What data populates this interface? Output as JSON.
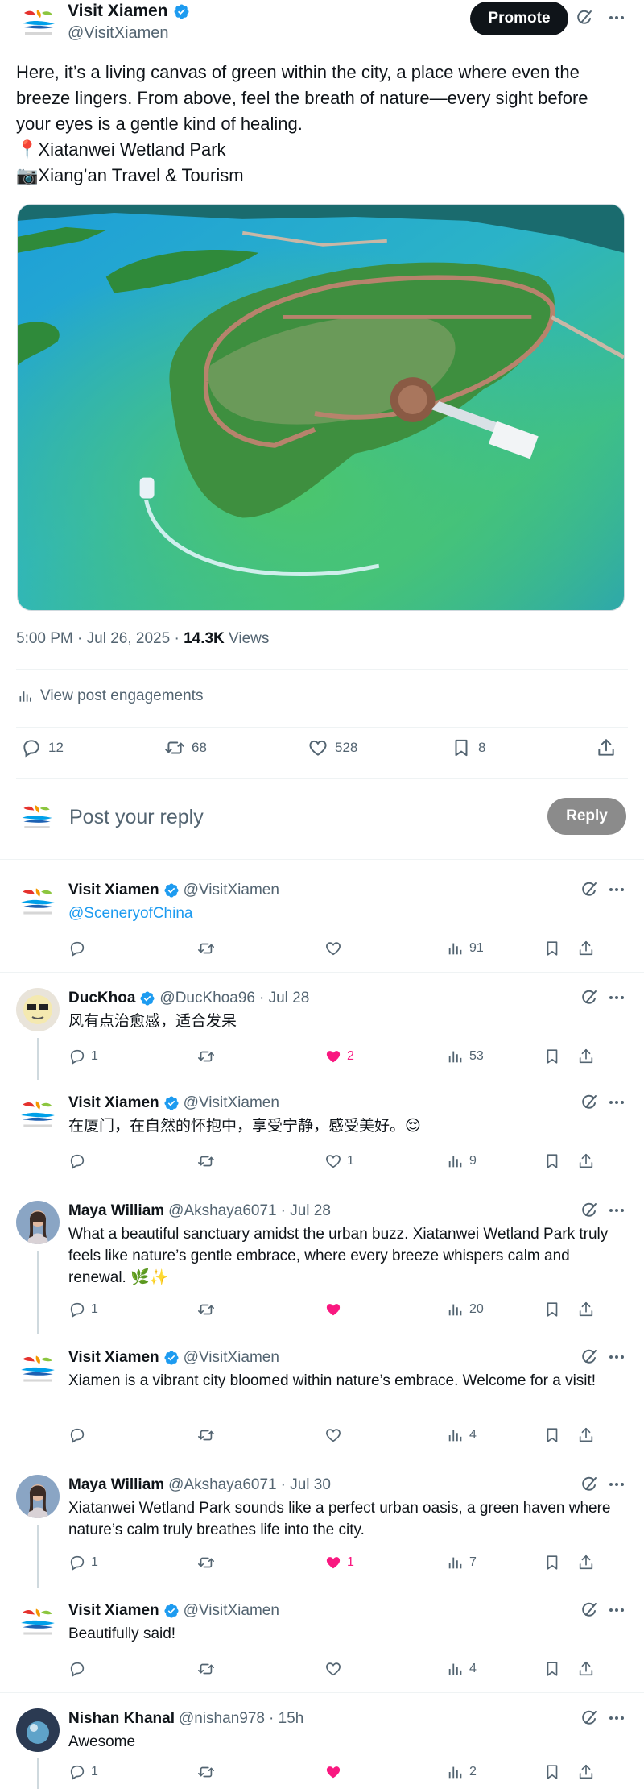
{
  "post": {
    "author": {
      "name": "Visit Xiamen",
      "handle": "@VisitXiamen"
    },
    "promote_label": "Promote",
    "lines": [
      "Here, it’s a living canvas of green within the city, a place where even the",
      "breeze lingers. From above, feel the breath of nature—every sight before",
      "your eyes is a gentle kind of healing.",
      "📍Xiatanwei Wetland Park",
      "📷Xiang’an Travel & Tourism"
    ],
    "time": "5:00 PM · Jul 26, 2025 · ",
    "views": "14.3K",
    "views_label": " Views",
    "engagements_label": "View post engagements",
    "stats": {
      "replies": "12",
      "reposts": "68",
      "likes": "528",
      "bookmarks": "8"
    }
  },
  "compose": {
    "placeholder": "Post your reply",
    "button": "Reply"
  },
  "replies": [
    {
      "name": "Visit Xiamen",
      "handle": "@VisitXiamen",
      "date": "",
      "text": "@SceneryofChina",
      "replies": "",
      "reposts": "",
      "likes": "",
      "liked": false,
      "views": "91"
    },
    {
      "name": "DucKhoa",
      "handle": "@DucKhoa96",
      "date": "· Jul 28",
      "text": "风有点治愈感，适合发呆",
      "replies": "1",
      "reposts": "",
      "likes": "2",
      "liked": true,
      "views": "53"
    },
    {
      "name": "Visit Xiamen",
      "handle": "@VisitXiamen",
      "date": "",
      "text": "在厦门，在自然的怀抱中，享受宁静，感受美好。😌",
      "replies": "",
      "reposts": "",
      "likes": "1",
      "liked": false,
      "views": "9"
    },
    {
      "name": "Maya William",
      "handle": "@Akshaya6071",
      "date": "· Jul 28",
      "text": "What a beautiful sanctuary amidst the urban buzz. Xiatanwei Wetland Park truly feels like nature’s gentle embrace, where every breeze whispers calm and renewal. 🌿✨",
      "replies": "1",
      "reposts": "",
      "likes": "",
      "liked": true,
      "views": "20"
    },
    {
      "name": "Visit Xiamen",
      "handle": "@VisitXiamen",
      "date": "",
      "text": "Xiamen is a vibrant city bloomed within nature’s embrace. Welcome for a visit!",
      "replies": "",
      "reposts": "",
      "likes": "",
      "liked": false,
      "views": "4"
    },
    {
      "name": "Maya William",
      "handle": "@Akshaya6071",
      "date": "· Jul 30",
      "text": "Xiatanwei Wetland Park sounds like a perfect urban oasis, a green haven where nature’s calm truly breathes life into the city.",
      "replies": "1",
      "reposts": "",
      "likes": "1",
      "liked": true,
      "views": "7"
    },
    {
      "name": "Visit Xiamen",
      "handle": "@VisitXiamen",
      "date": "",
      "text": "Beautifully said!",
      "replies": "",
      "reposts": "",
      "likes": "",
      "liked": false,
      "views": "4"
    },
    {
      "name": "Nishan Khanal",
      "handle": "@nishan978",
      "date": "· 15h",
      "text": "Awesome",
      "replies": "1",
      "reposts": "",
      "likes": "",
      "liked": true,
      "views": "2"
    }
  ],
  "colors": {
    "accent": "#1d9bf0",
    "like": "#f91880",
    "muted": "#536471"
  }
}
